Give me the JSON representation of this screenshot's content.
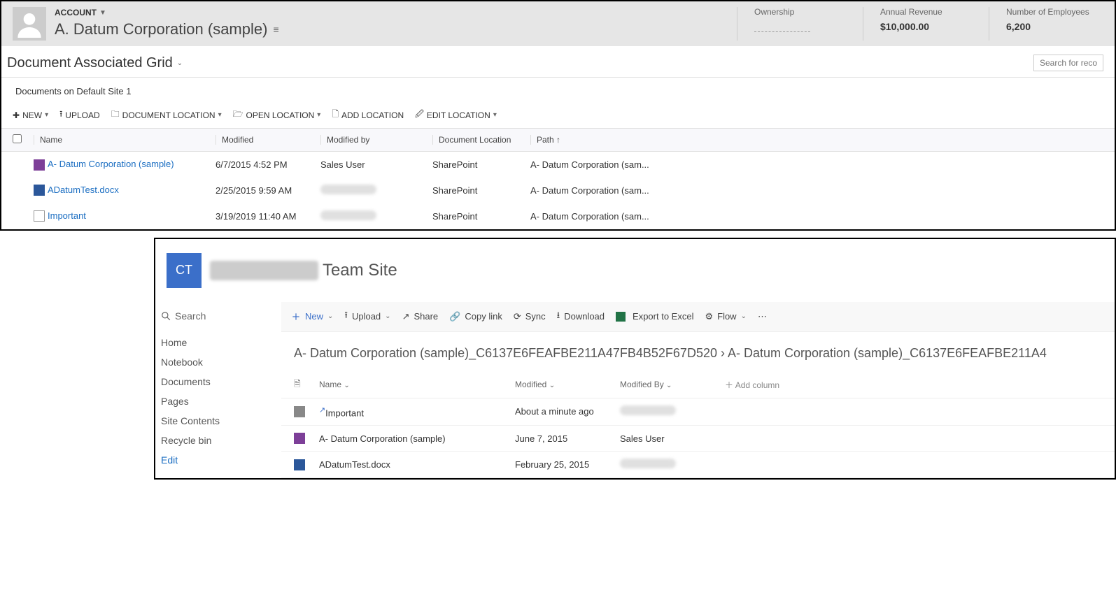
{
  "crm": {
    "account_label": "ACCOUNT",
    "account_name": "A. Datum Corporation (sample)",
    "metrics": {
      "ownership_label": "Ownership",
      "revenue_label": "Annual Revenue",
      "revenue_value": "$10,000.00",
      "employees_label": "Number of Employees",
      "employees_value": "6,200"
    },
    "grid_title": "Document Associated Grid",
    "search_placeholder": "Search for reco",
    "site_label": "Documents on Default Site 1",
    "cmdbar": {
      "new": "NEW",
      "upload": "UPLOAD",
      "doc_location": "DOCUMENT LOCATION",
      "open_location": "OPEN LOCATION",
      "add_location": "ADD LOCATION",
      "edit_location": "EDIT LOCATION"
    },
    "columns": {
      "name": "Name",
      "modified": "Modified",
      "modified_by": "Modified by",
      "doc_location": "Document Location",
      "path": "Path ↑"
    },
    "rows": [
      {
        "name": "A- Datum Corporation (sample)",
        "modified": "6/7/2015 4:52 PM",
        "modified_by": "Sales User",
        "location": "SharePoint",
        "path": "A- Datum Corporation (sam...",
        "icon": "onenote"
      },
      {
        "name": "ADatumTest.docx",
        "modified": "2/25/2015 9:59 AM",
        "modified_by": "",
        "location": "SharePoint",
        "path": "A- Datum Corporation (sam...",
        "icon": "word"
      },
      {
        "name": "Important",
        "modified": "3/19/2019 11:40 AM",
        "modified_by": "",
        "location": "SharePoint",
        "path": "A- Datum Corporation (sam...",
        "icon": "file"
      }
    ]
  },
  "sp": {
    "logo_initials": "CT",
    "title_prefix_hidden": "CRMC3Online",
    "title": "Team Site",
    "search_label": "Search",
    "nav": [
      "Home",
      "Notebook",
      "Documents",
      "Pages",
      "Site Contents",
      "Recycle bin"
    ],
    "nav_edit": "Edit",
    "cmdbar": {
      "new": "New",
      "upload": "Upload",
      "share": "Share",
      "copy": "Copy link",
      "sync": "Sync",
      "download": "Download",
      "export": "Export to Excel",
      "flow": "Flow"
    },
    "breadcrumb": "A- Datum Corporation (sample)_C6137E6FEAFBE211A47FB4B52F67D520 › A- Datum Corporation (sample)_C6137E6FEAFBE211A4",
    "columns": {
      "name": "Name",
      "modified": "Modified",
      "modified_by": "Modified By",
      "add": "Add column"
    },
    "rows": [
      {
        "name": "Important",
        "modified": "About a minute ago",
        "modified_by": "",
        "icon": "folder",
        "shortcut": true
      },
      {
        "name": "A- Datum Corporation (sample)",
        "modified": "June 7, 2015",
        "modified_by": "Sales User",
        "icon": "onenote"
      },
      {
        "name": "ADatumTest.docx",
        "modified": "February 25, 2015",
        "modified_by": "",
        "icon": "word"
      }
    ]
  }
}
